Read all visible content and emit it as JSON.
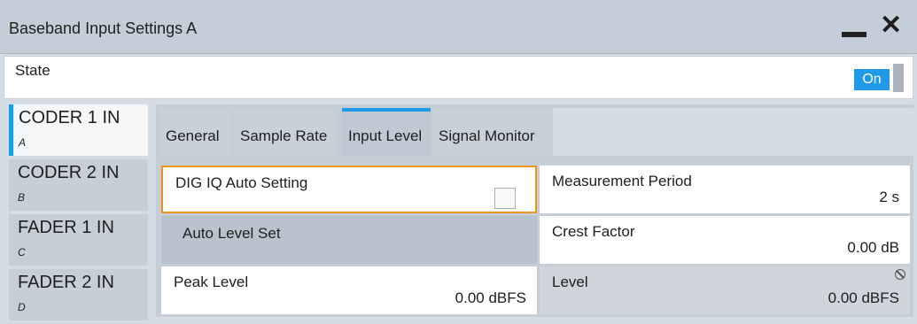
{
  "window": {
    "title": "Baseband Input Settings A",
    "minimize_icon": "minimize-icon",
    "close_icon": "close-icon"
  },
  "state": {
    "label": "State",
    "toggle_value": "On"
  },
  "sidebar": {
    "items": [
      {
        "name": "CODER 1 IN",
        "sub": "A"
      },
      {
        "name": "CODER 2 IN",
        "sub": "B"
      },
      {
        "name": "FADER 1 IN",
        "sub": "C"
      },
      {
        "name": "FADER 2 IN",
        "sub": "D"
      }
    ]
  },
  "tabs": [
    "General",
    "Sample Rate",
    "Input Level",
    "Signal Monitor"
  ],
  "fields": {
    "dig_iq_auto": {
      "label": "DIG IQ Auto Setting",
      "checked": false
    },
    "measurement_period": {
      "label": "Measurement Period",
      "value": "2 s"
    },
    "auto_level_set": {
      "label": "Auto Level Set"
    },
    "crest_factor": {
      "label": "Crest Factor",
      "value": "0.00 dB"
    },
    "peak_level": {
      "label": "Peak Level",
      "value": "0.00 dBFS"
    },
    "level": {
      "label": "Level",
      "value": "0.00 dBFS"
    }
  },
  "colors": {
    "accent": "#1f9ae6",
    "focus": "#f0921e"
  }
}
